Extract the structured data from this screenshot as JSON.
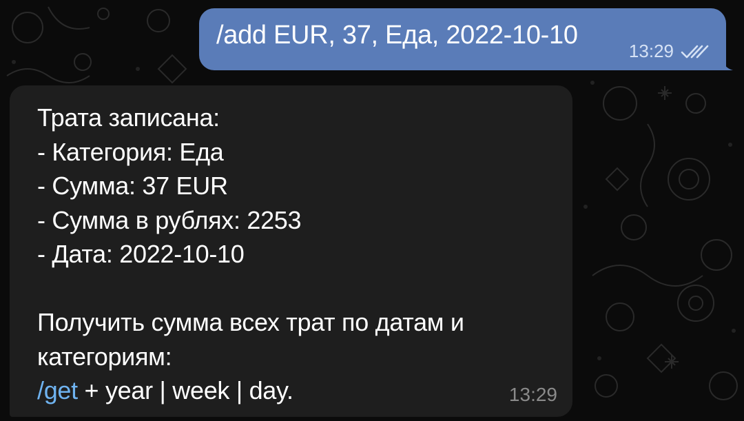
{
  "outgoing_message": {
    "text": "/add EUR, 37, Еда, 2022-10-10",
    "time": "13:29",
    "status_icon": "double-check-read-icon"
  },
  "incoming_message": {
    "lines": [
      "Трата записана:",
      "- Категория: Еда",
      "- Сумма: 37 EUR",
      "- Сумма в рублях: 2253",
      "- Дата: 2022-10-10",
      "",
      "Получить сумма всех трат по датам и",
      "категориям:"
    ],
    "command_link": "/get",
    "command_rest": " + year | week | day.",
    "time": "13:29"
  },
  "colors": {
    "outgoing_bubble": "#5a7cb8",
    "incoming_bubble": "#1e1e1e",
    "link": "#6fb3f0",
    "background": "#0b0b0b"
  }
}
